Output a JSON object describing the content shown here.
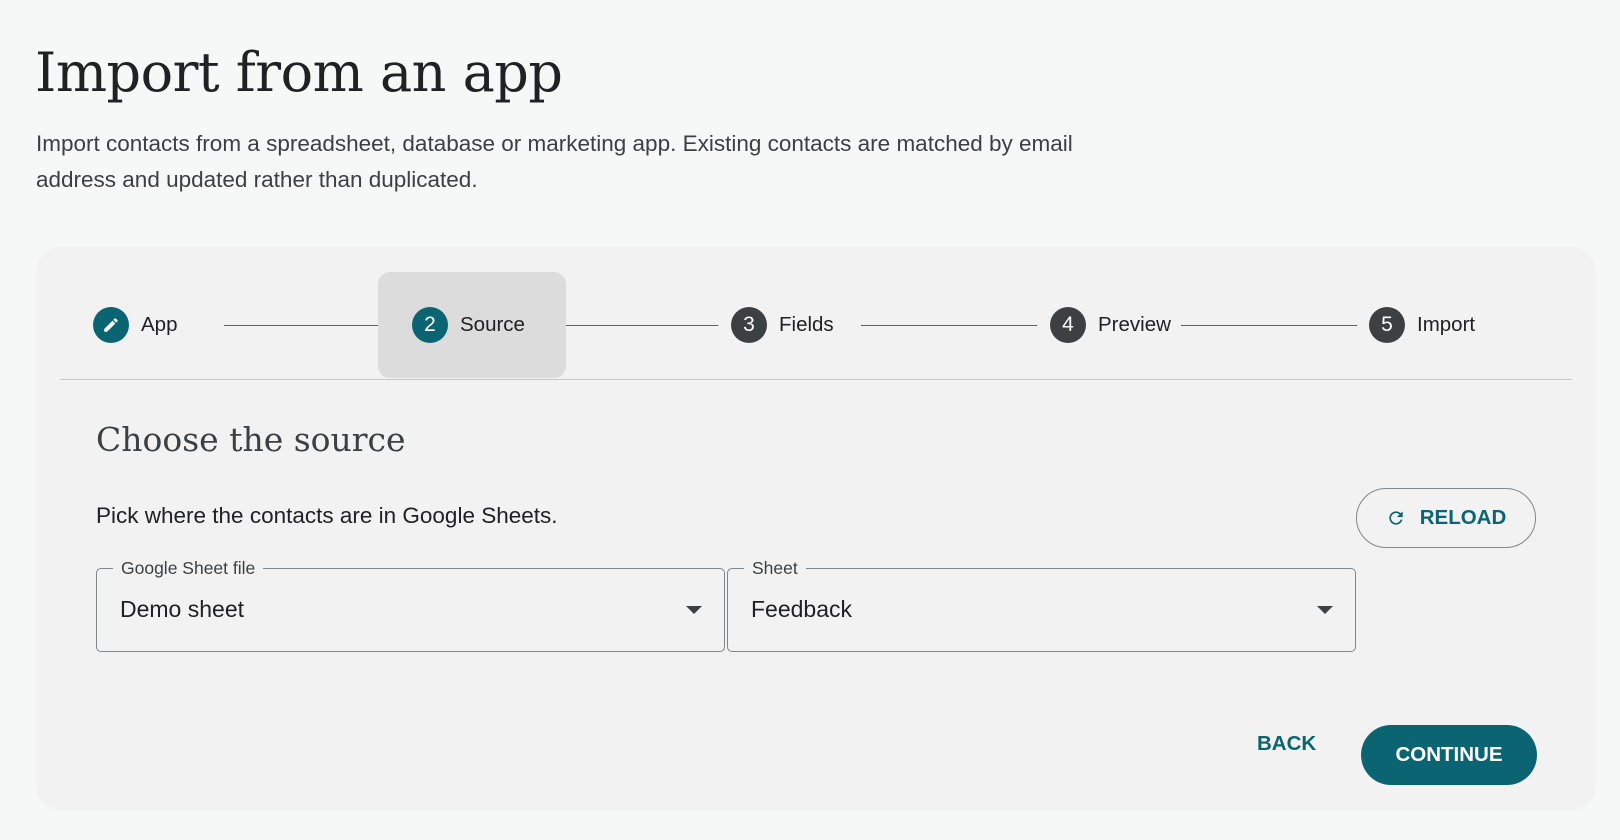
{
  "page": {
    "title": "Import from an app",
    "description": "Import contacts from a spreadsheet, database or marketing app. Existing contacts are matched by email address and updated rather than duplicated."
  },
  "stepper": {
    "active_step": 2,
    "steps": [
      {
        "number": "",
        "label": "App",
        "state": "completed",
        "icon": "pencil-icon"
      },
      {
        "number": "2",
        "label": "Source",
        "state": "active"
      },
      {
        "number": "3",
        "label": "Fields",
        "state": "pending"
      },
      {
        "number": "4",
        "label": "Preview",
        "state": "pending"
      },
      {
        "number": "5",
        "label": "Import",
        "state": "pending"
      }
    ]
  },
  "section": {
    "heading": "Choose the source",
    "instruction": "Pick where the contacts are in Google Sheets.",
    "reload_label": "RELOAD",
    "reload_icon": "refresh-icon"
  },
  "fields": {
    "file": {
      "label": "Google Sheet file",
      "value": "Demo sheet"
    },
    "sheet": {
      "label": "Sheet",
      "value": "Feedback"
    }
  },
  "actions": {
    "back_label": "BACK",
    "continue_label": "CONTINUE"
  },
  "colors": {
    "accent": "#0b6471",
    "step_pending": "#3c4043",
    "page_background": "#f6f8f8",
    "card_background": "#f2f2f2"
  }
}
